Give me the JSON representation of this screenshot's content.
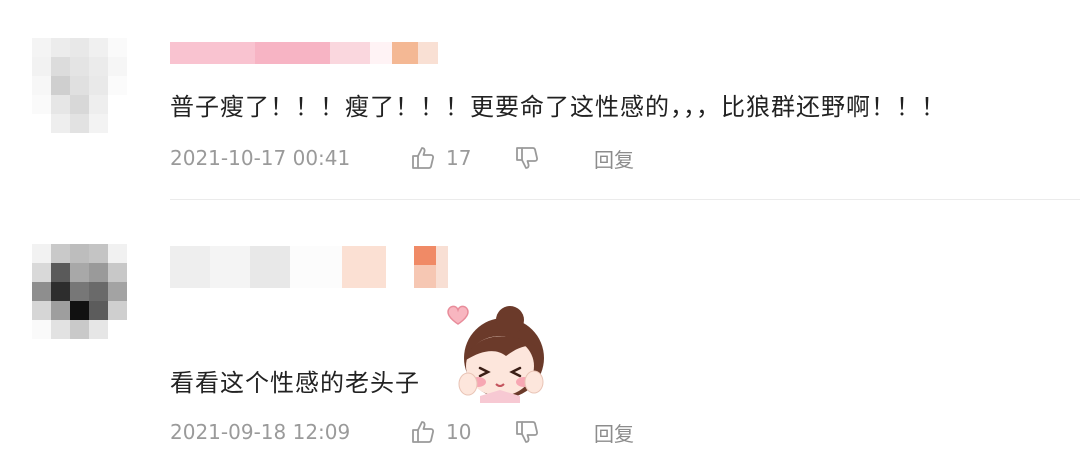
{
  "comments": [
    {
      "text": "普子瘦了！！！瘦了！！！更要命了这性感的，，，比狼群还野啊！！！",
      "timestamp": "2021-10-17 00:41",
      "likes": "17",
      "reply_label": "回复"
    },
    {
      "text": "看看这个性感的老头子",
      "timestamp": "2021-09-18 12:09",
      "likes": "10",
      "reply_label": "回复"
    }
  ],
  "icons": {
    "like": "thumbs-up-icon",
    "dislike": "thumbs-down-icon",
    "sticker": "cartoon-girl-heart-sticker"
  },
  "colors": {
    "text": "#222222",
    "meta": "#9a9a9a",
    "divider": "#ebebeb",
    "username_mosaic_1": "#f7b6c6",
    "username_mosaic_accent": "#f0a070",
    "avatar_1": "#e3e3e3",
    "avatar_2": "#3a3a3a"
  }
}
